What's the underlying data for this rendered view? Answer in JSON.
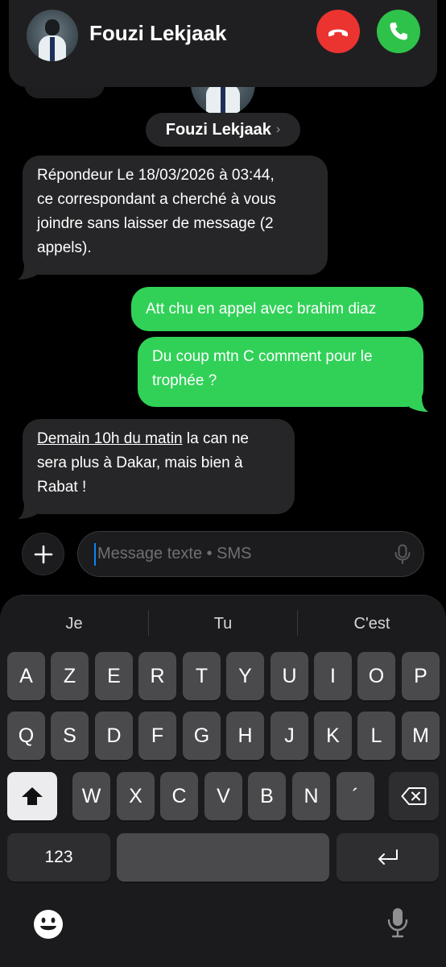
{
  "call": {
    "contact_name": "Fouzi Lekjaak"
  },
  "conversation": {
    "contact_name": "Fouzi Lekjaak",
    "chevron": "›"
  },
  "messages": [
    {
      "direction": "incoming",
      "lines": [
        "Répondeur Le 18/03/2026 à 03:44,",
        "ce correspondant a cherché à vous",
        "joindre sans laisser de message (2",
        "appels)."
      ]
    },
    {
      "direction": "outgoing",
      "lines": [
        "Att chu en appel avec brahim diaz"
      ]
    },
    {
      "direction": "outgoing",
      "lines": [
        "Du coup mtn C comment pour le",
        "trophée ?"
      ]
    },
    {
      "direction": "incoming",
      "link_text": "Demain 10h du matin",
      "lines_after_link": [
        " la can ne",
        "sera plus à Dakar, mais bien à",
        "Rabat !"
      ]
    }
  ],
  "compose": {
    "placeholder": "Message texte • SMS"
  },
  "keyboard": {
    "suggestions": [
      "Je",
      "Tu",
      "C'est"
    ],
    "row1": [
      "A",
      "Z",
      "E",
      "R",
      "T",
      "Y",
      "U",
      "I",
      "O",
      "P"
    ],
    "row2": [
      "Q",
      "S",
      "D",
      "F",
      "G",
      "H",
      "J",
      "K",
      "L",
      "M"
    ],
    "row3": [
      "W",
      "X",
      "C",
      "V",
      "B",
      "N",
      "´"
    ],
    "numbers_key": "123"
  },
  "icons": {
    "decline": "phone-down-icon",
    "accept": "phone-icon",
    "plus": "plus-icon",
    "mic": "microphone-icon",
    "shift": "shift-arrow-icon",
    "delete": "delete-backspace-icon",
    "return": "return-arrow-icon",
    "emoji": "emoji-icon"
  },
  "colors": {
    "decline": "#eb3330",
    "accept": "#2fc24a",
    "outgoing_bubble": "#31d158",
    "incoming_bubble": "#262628",
    "caret": "#0a84ff"
  }
}
